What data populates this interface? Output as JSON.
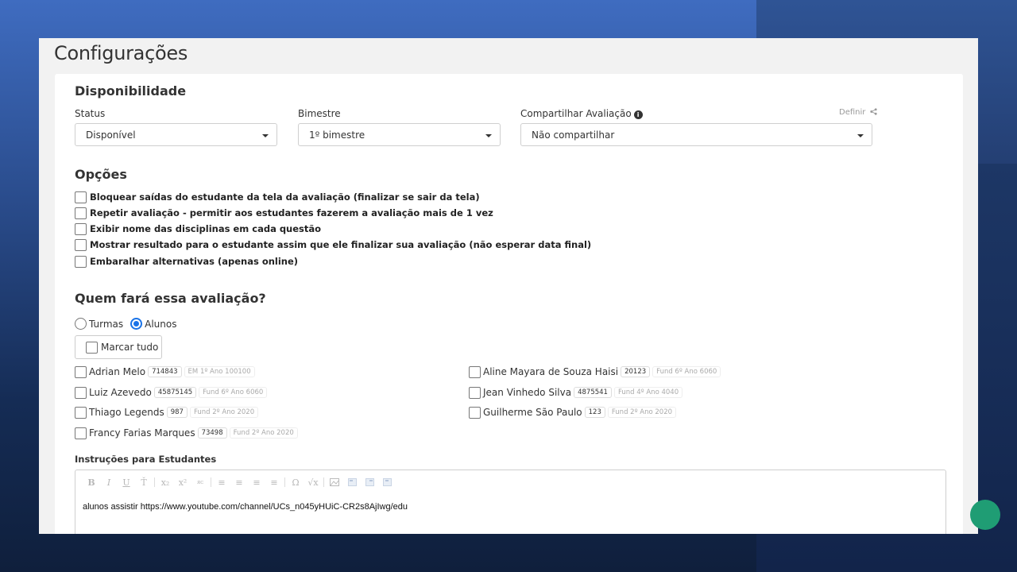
{
  "page": {
    "title": "Configurações"
  },
  "availability": {
    "title": "Disponibilidade",
    "status": {
      "label": "Status",
      "value": "Disponível"
    },
    "bimestre": {
      "label": "Bimestre",
      "value": "1º bimestre"
    },
    "share": {
      "label": "Compartilhar Avaliação",
      "value": "Não compartilhar",
      "define_link": "Definir"
    }
  },
  "options": {
    "title": "Opções",
    "items": [
      "Bloquear saídas do estudante da tela da avaliação (finalizar se sair da tela)",
      "Repetir avaliação - permitir aos estudantes fazerem a avaliação mais de 1 vez",
      "Exibir nome das disciplinas em cada questão",
      "Mostrar resultado para o estudante assim que ele finalizar sua avaliação (não esperar data final)",
      "Embaralhar alternativas (apenas online)"
    ]
  },
  "audience": {
    "title": "Quem fará essa avaliação?",
    "radio_turmas": "Turmas",
    "radio_alunos": "Alunos",
    "selected": "Alunos",
    "mark_all": "Marcar tudo",
    "students": [
      {
        "name": "Adrian Melo",
        "id": "714843",
        "class": "EM 1º Ano 100100"
      },
      {
        "name": "Luiz Azevedo",
        "id": "45875145",
        "class": "Fund 6º Ano 6060"
      },
      {
        "name": "Thiago Legends",
        "id": "987",
        "class": "Fund 2º Ano 2020"
      },
      {
        "name": "Francy Farias Marques",
        "id": "73498",
        "class": "Fund 2º Ano 2020"
      },
      {
        "name": "Aline Mayara de Souza Haisi",
        "id": "20123",
        "class": "Fund 6º Ano 6060"
      },
      {
        "name": "Jean Vinhedo Silva",
        "id": "4875541",
        "class": "Fund 4º Ano 4040"
      },
      {
        "name": "Guilherme São Paulo",
        "id": "123",
        "class": "Fund 2º Ano 2020"
      }
    ]
  },
  "instructions": {
    "label": "Instruções para Estudantes",
    "content": "alunos assistir https://www.youtube.com/channel/UCs_n045yHUiC-CR2s8AjIwg/edu",
    "toolbar": [
      "B",
      "I",
      "U",
      "Ť",
      "x₂",
      "x²",
      "ᴙᴄ",
      "≡",
      "≡",
      "≡",
      "≡",
      "Ω",
      "√x"
    ]
  },
  "colors": {
    "accent": "#1a73e8",
    "fab": "#1f9d74"
  }
}
